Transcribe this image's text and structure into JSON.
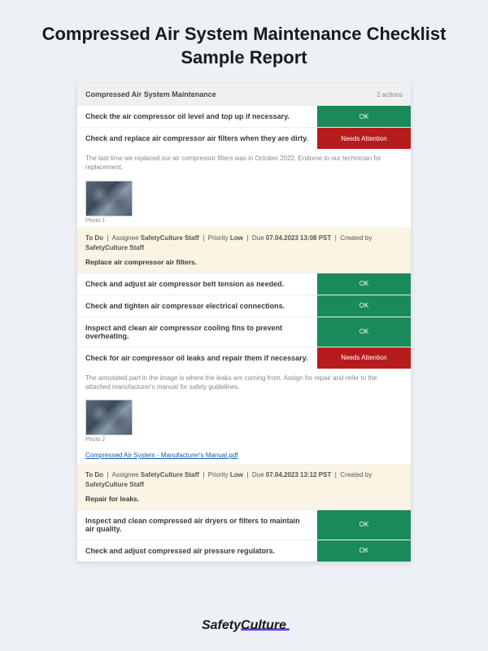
{
  "page_title": "Compressed Air System Maintenance Checklist Sample Report",
  "section": {
    "title": "Compressed Air System Maintenance",
    "actions_label": "2 actions"
  },
  "items": [
    {
      "label": "Check the air compressor oil level and top up if necessary.",
      "status": "OK",
      "status_type": "ok"
    },
    {
      "label": "Check and replace air compressor air filters when they are dirty.",
      "status": "Needs Attention",
      "status_type": "attn",
      "note": "The last time we replaced our air compressor filters was in October 2022. Endorse to our technician for replacement.",
      "photo_caption": "Photo 1",
      "todo": {
        "status_label": "To Do",
        "assignee_label": "Assignee",
        "assignee": "SafetyCulture Staff",
        "priority_label": "Priority",
        "priority": "Low",
        "due_label": "Due",
        "due": "07.04.2023 13:08 PST",
        "created_label": "Created by",
        "created_by": "SafetyCulture Staff",
        "task": "Replace air compressor air filters."
      }
    },
    {
      "label": "Check and adjust air compressor belt tension as needed.",
      "status": "OK",
      "status_type": "ok"
    },
    {
      "label": "Check and tighten air compressor electrical connections.",
      "status": "OK",
      "status_type": "ok"
    },
    {
      "label": "Inspect and clean air compressor cooling fins to prevent overheating.",
      "status": "OK",
      "status_type": "ok"
    },
    {
      "label": "Check for air compressor oil leaks and repair them if necessary.",
      "status": "Needs Attention",
      "status_type": "attn",
      "note": "The annotated part in the image is where the leaks are coming from. Assign for repair and refer to the attached manufacturer's manual for safety guidelines.",
      "photo_caption": "Photo 2",
      "attachment": "Compressed Air System - Manufacturer's Manual.pdf",
      "todo": {
        "status_label": "To Do",
        "assignee_label": "Assignee",
        "assignee": "SafetyCulture Staff",
        "priority_label": "Priority",
        "priority": "Low",
        "due_label": "Due",
        "due": "07.04.2023 13:12 PST",
        "created_label": "Created by",
        "created_by": "SafetyCulture Staff",
        "task": "Repair for leaks."
      }
    },
    {
      "label": "Inspect and clean compressed air dryers or filters to maintain air quality.",
      "status": "OK",
      "status_type": "ok"
    },
    {
      "label": "Check and adjust compressed air pressure regulators.",
      "status": "OK",
      "status_type": "ok"
    }
  ],
  "brand": "SafetyCulture"
}
